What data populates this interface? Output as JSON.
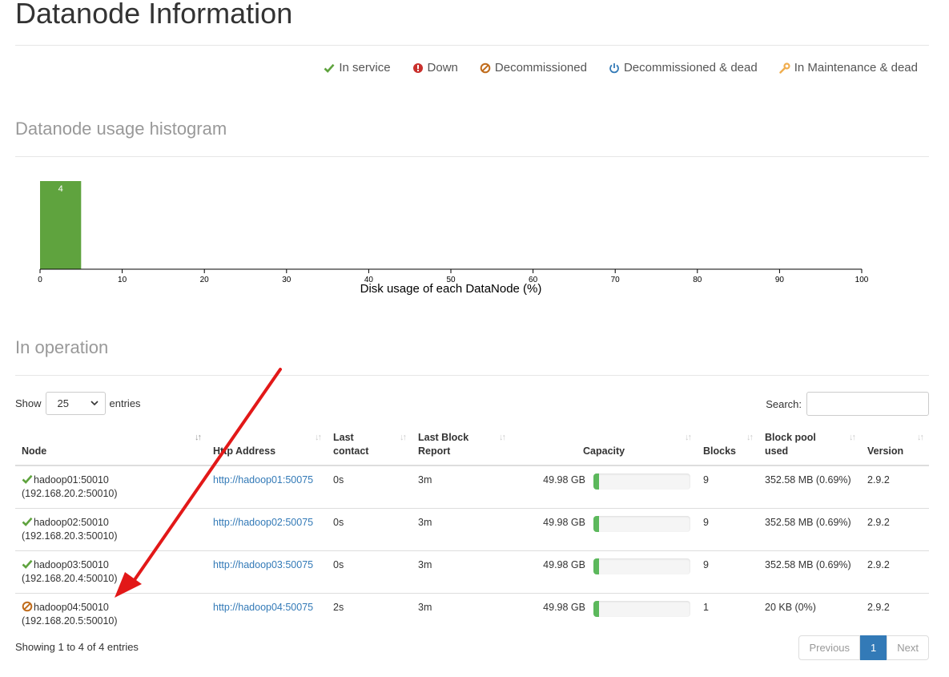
{
  "page": {
    "title": "Datanode Information"
  },
  "legend": {
    "in_service": "In service",
    "down": "Down",
    "decommissioned": "Decommissioned",
    "decommissioned_dead": "Decommissioned & dead",
    "maintenance_dead": "In Maintenance & dead"
  },
  "histogram": {
    "title": "Datanode usage histogram",
    "xlabel": "Disk usage of each DataNode (%)",
    "ticks": [
      "0",
      "10",
      "20",
      "30",
      "40",
      "50",
      "60",
      "70",
      "80",
      "90",
      "100"
    ],
    "bar_label": "4"
  },
  "chart_data": {
    "type": "bar",
    "title": "Datanode usage histogram",
    "xlabel": "Disk usage of each DataNode (%)",
    "xlim": [
      0,
      100
    ],
    "bins": [
      {
        "from": 0,
        "to": 5,
        "count": 4
      }
    ],
    "bar_color": "#5fa33e"
  },
  "operation": {
    "title": "In operation",
    "show_label": "Show",
    "entries_label": "entries",
    "page_size": "25",
    "search_label": "Search:",
    "columns": {
      "node": "Node",
      "http": "Http Address",
      "last_contact_1": "Last",
      "last_contact_2": "contact",
      "last_block_1": "Last Block",
      "last_block_2": "Report",
      "capacity": "Capacity",
      "blocks": "Blocks",
      "pool_1": "Block pool",
      "pool_2": "used",
      "version": "Version"
    },
    "rows": [
      {
        "status": "in-service",
        "node": "hadoop01:50010",
        "ip": "(192.168.20.2:50010)",
        "http": "http://hadoop01:50075",
        "contact": "0s",
        "report": "3m",
        "capacity": "49.98 GB",
        "usage": 0.69,
        "blocks": "9",
        "pool": "352.58 MB (0.69%)",
        "version": "2.9.2"
      },
      {
        "status": "in-service",
        "node": "hadoop02:50010",
        "ip": "(192.168.20.3:50010)",
        "http": "http://hadoop02:50075",
        "contact": "0s",
        "report": "3m",
        "capacity": "49.98 GB",
        "usage": 0.69,
        "blocks": "9",
        "pool": "352.58 MB (0.69%)",
        "version": "2.9.2"
      },
      {
        "status": "in-service",
        "node": "hadoop03:50010",
        "ip": "(192.168.20.4:50010)",
        "http": "http://hadoop03:50075",
        "contact": "0s",
        "report": "3m",
        "capacity": "49.98 GB",
        "usage": 0.69,
        "blocks": "9",
        "pool": "352.58 MB (0.69%)",
        "version": "2.9.2"
      },
      {
        "status": "decommissioned",
        "node": "hadoop04:50010",
        "ip": "(192.168.20.5:50010)",
        "http": "http://hadoop04:50075",
        "contact": "2s",
        "report": "3m",
        "capacity": "49.98 GB",
        "usage": 0.0,
        "blocks": "1",
        "pool": "20 KB (0%)",
        "version": "2.9.2"
      }
    ],
    "info": "Showing 1 to 4 of 4 entries",
    "pager": {
      "previous": "Previous",
      "current": "1",
      "next": "Next"
    }
  },
  "colors": {
    "in_service": "#5fa33e",
    "down": "#d9534f",
    "decommissioned": "#c06c1c",
    "decommissioned_dead": "#337ab7",
    "maintenance": "#f0ad4e",
    "annotation_arrow": "#e21818"
  }
}
